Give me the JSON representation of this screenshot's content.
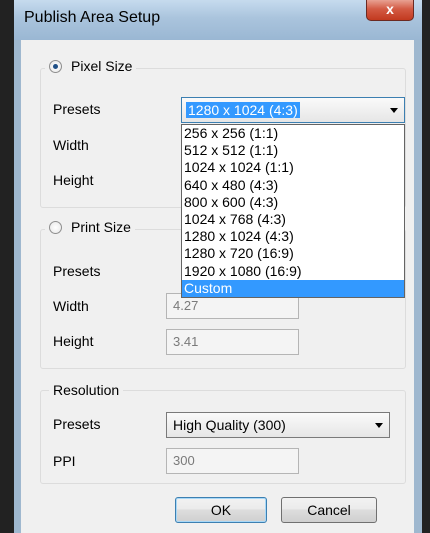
{
  "window": {
    "title": "Publish Area Setup",
    "close_glyph": "x"
  },
  "pixel_size": {
    "label": "Pixel Size",
    "selected": true,
    "presets_label": "Presets",
    "presets_value": "1280 x 1024 (4:3)",
    "width_label": "Width",
    "height_label": "Height",
    "dropdown_open": true,
    "dropdown_options": [
      "256 x 256 (1:1)",
      "512 x 512 (1:1)",
      "1024 x 1024 (1:1)",
      "640 x 480 (4:3)",
      "800 x 600 (4:3)",
      "1024 x 768 (4:3)",
      "1280 x 1024 (4:3)",
      "1280 x 720 (16:9)",
      "1920 x 1080 (16:9)",
      "Custom"
    ],
    "highlighted_option": "Custom"
  },
  "print_size": {
    "label": "Print Size",
    "selected": false,
    "presets_label": "Presets",
    "width_label": "Width",
    "width_value": "4.27",
    "height_label": "Height",
    "height_value": "3.41"
  },
  "resolution": {
    "label": "Resolution",
    "presets_label": "Presets",
    "presets_value": "High Quality (300)",
    "ppi_label": "PPI",
    "ppi_value": "300"
  },
  "buttons": {
    "ok": "OK",
    "cancel": "Cancel"
  },
  "colors": {
    "selection": "#3399ff",
    "close_button": "#c2391f",
    "window_frame": "#9fb8cf"
  }
}
